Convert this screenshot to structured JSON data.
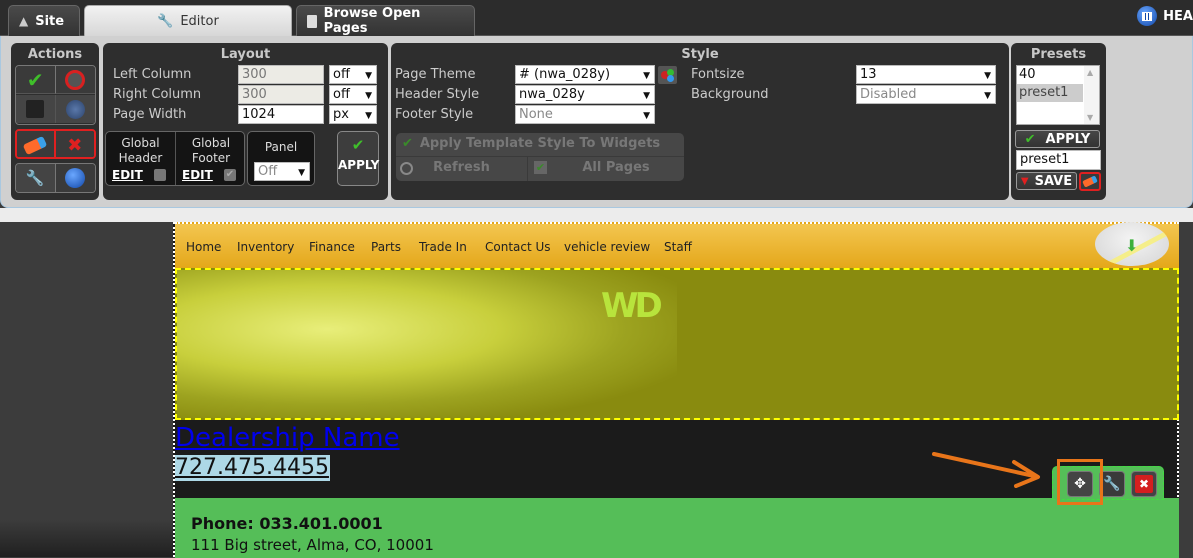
{
  "tabs": [
    {
      "label": "Site",
      "icon": "home-icon"
    },
    {
      "label": "Editor",
      "icon": "wrench-icon",
      "active": true
    },
    {
      "label": "Browse Open Pages",
      "icon": "pages-icon"
    }
  ],
  "head_button": {
    "label": "HEA",
    "icon": "grid-icon"
  },
  "actions": {
    "title": "Actions",
    "buttons": [
      "confirm",
      "cancel",
      "save",
      "globe",
      "erase",
      "delete",
      "tools",
      "profile"
    ]
  },
  "layout": {
    "title": "Layout",
    "left_column": {
      "label": "Left Column",
      "value": "300",
      "unit": "off"
    },
    "right_column": {
      "label": "Right Column",
      "value": "300",
      "unit": "off"
    },
    "page_width": {
      "label": "Page Width",
      "value": "1024",
      "unit": "px"
    },
    "global_header": {
      "label1": "Global",
      "label2": "Header",
      "edit": "EDIT",
      "checked": false
    },
    "global_footer": {
      "label1": "Global",
      "label2": "Footer",
      "edit": "EDIT",
      "checked": true
    },
    "panel": {
      "label": "Panel",
      "value": "Off"
    },
    "apply": "APPLY"
  },
  "style": {
    "title": "Style",
    "page_theme": {
      "label": "Page Theme",
      "value": "# (nwa_028y)"
    },
    "header_style": {
      "label": "Header Style",
      "value": "nwa_028y"
    },
    "footer_style": {
      "label": "Footer Style",
      "value": "None"
    },
    "fontsize": {
      "label": "Fontsize",
      "value": "13"
    },
    "background": {
      "label": "Background",
      "value": "Disabled"
    },
    "apply_template": "Apply Template Style To Widgets",
    "refresh": "Refresh",
    "all_pages": "All Pages"
  },
  "presets": {
    "title": "Presets",
    "items": [
      "40",
      "preset1"
    ],
    "selected": "preset1",
    "apply": "APPLY",
    "name_value": "preset1",
    "save": "SAVE"
  },
  "site": {
    "nav": [
      "Home",
      "Inventory",
      "Finance",
      "Parts",
      "Trade In",
      "Contact Us",
      "vehicle review",
      "Staff"
    ],
    "logo": "WD",
    "dealership_name": "Dealership Name",
    "dealership_phone": "727.475.4455",
    "footer_phone": "Phone: 033.401.0001",
    "footer_address": "111 Big street, Alma, CO, 10001"
  },
  "colors": {
    "accent": "#e8751a",
    "nav_bg": "#f0bd3c",
    "banner": "#898b0f",
    "widget_green": "#55be58",
    "link": "#0000ee"
  }
}
